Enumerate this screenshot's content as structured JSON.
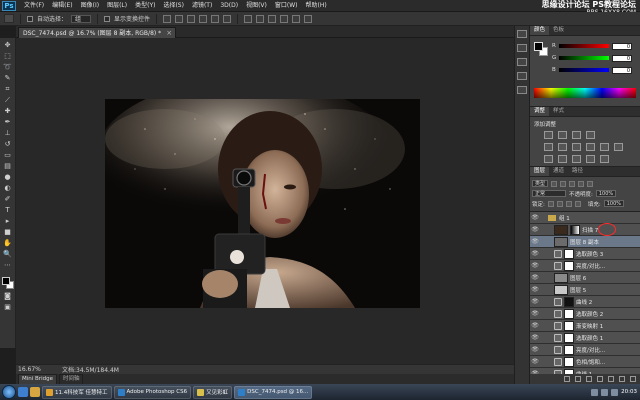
{
  "app": {
    "logo": "Ps"
  },
  "menubar": {
    "items": [
      "文件(F)",
      "编辑(E)",
      "图像(I)",
      "图层(L)",
      "类型(Y)",
      "选择(S)",
      "滤镜(T)",
      "3D(D)",
      "视图(V)",
      "窗口(W)",
      "帮助(H)"
    ],
    "watermark_line1": "思缘设计论坛",
    "watermark_line2": "PS教程论坛",
    "watermark_line3": "BBS.16XX8.COM"
  },
  "options": {
    "auto_select_label": "自动选择：",
    "auto_select_value": "组",
    "show_transform_label": "显示变换控件"
  },
  "document": {
    "tab_title": "DSC_7474.psd @ 16.7% (图层 8 副本, RGB/8) *",
    "close": "×"
  },
  "status": {
    "zoom": "16.67%",
    "doc_size": "文档:34.5M/184.4M"
  },
  "minibridge": {
    "tabs": [
      "Mini Bridge",
      "时间轴"
    ]
  },
  "color_panel": {
    "tabs": [
      "颜色",
      "色板"
    ],
    "sliders": [
      {
        "letter": "R",
        "value": "0",
        "color_from": "#000000",
        "color_to": "#ff0000"
      },
      {
        "letter": "G",
        "value": "0",
        "color_from": "#000000",
        "color_to": "#00ff00"
      },
      {
        "letter": "B",
        "value": "0",
        "color_from": "#000000",
        "color_to": "#0000ff"
      }
    ]
  },
  "adjust_panel": {
    "tabs": [
      "调整",
      "样式"
    ],
    "title": "添加调整"
  },
  "layers_panel": {
    "tabs": [
      "图层",
      "通道",
      "路径"
    ],
    "filter_kind": "类型",
    "blend_mode": "正常",
    "opacity_label": "不透明度:",
    "opacity_value": "100%",
    "lock_label": "锁定:",
    "fill_label": "填充:",
    "fill_value": "100%",
    "layers": [
      {
        "name": "组 1",
        "kind": "group"
      },
      {
        "name": "扫描 7",
        "kind": "pixel",
        "thumb": "#3a2a1e",
        "mask": "#ffffff",
        "mask_dark": true,
        "highlight": true
      },
      {
        "name": "图层 8 副本",
        "kind": "pixel",
        "thumb": "#6b6b6b",
        "selected": true
      },
      {
        "name": "选取颜色 3",
        "kind": "adjust",
        "mask": "#ffffff"
      },
      {
        "name": "亮度/对比...",
        "kind": "adjust",
        "mask": "#ffffff",
        "mask_dark": true
      },
      {
        "name": "图层 6",
        "kind": "pixel",
        "thumb": "#8a8a8a"
      },
      {
        "name": "图层 5",
        "kind": "pixel",
        "thumb": "#c9c9c9"
      },
      {
        "name": "曲线 2",
        "kind": "adjust",
        "mask": "#111111"
      },
      {
        "name": "选取颜色 2",
        "kind": "adjust",
        "mask": "#ffffff"
      },
      {
        "name": "渐变映射 1",
        "kind": "adjust",
        "mask": "#ffffff"
      },
      {
        "name": "选取颜色 1",
        "kind": "adjust",
        "mask": "#ffffff"
      },
      {
        "name": "亮度/对比...",
        "kind": "adjust",
        "mask": "#ffffff"
      },
      {
        "name": "色相/饱和...",
        "kind": "adjust",
        "mask": "#ffffff"
      },
      {
        "name": "曲线 1",
        "kind": "adjust",
        "mask": "#ffffff"
      }
    ]
  },
  "taskbar": {
    "tasks": [
      {
        "label": "11.4科技军 佳慧特工",
        "active": false,
        "icon_color": "#e0a030"
      },
      {
        "label": "Adobe Photoshop CS6",
        "active": false,
        "icon_color": "#2f7fc8"
      },
      {
        "label": "又见彩虹",
        "active": false,
        "icon_color": "#d9c04a"
      },
      {
        "label": "DSC_7474.psd @ 16...",
        "active": true,
        "icon_color": "#2f7fc8"
      }
    ],
    "clock": "20:03"
  }
}
